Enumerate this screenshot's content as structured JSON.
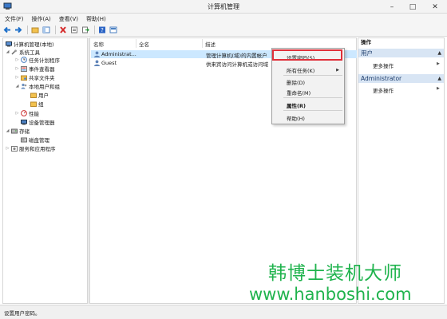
{
  "window": {
    "title": "计算机管理"
  },
  "menu": [
    "文件(F)",
    "操作(A)",
    "查看(V)",
    "帮助(H)"
  ],
  "tree": [
    {
      "label": "计算机管理(本地)",
      "icon": "computer-icon",
      "arrow": "",
      "level": 0
    },
    {
      "label": "系统工具",
      "icon": "tools-icon",
      "arrow": "◢",
      "level": 1
    },
    {
      "label": "任务计划程序",
      "icon": "clock-icon",
      "arrow": "▷",
      "level": 2
    },
    {
      "label": "事件查看器",
      "icon": "event-viewer-icon",
      "arrow": "▷",
      "level": 2
    },
    {
      "label": "共享文件夹",
      "icon": "shared-folder-icon",
      "arrow": "▷",
      "level": 2
    },
    {
      "label": "本地用户和组",
      "icon": "users-icon",
      "arrow": "◢",
      "level": 2
    },
    {
      "label": "用户",
      "icon": "folder-icon",
      "arrow": "",
      "level": 3
    },
    {
      "label": "组",
      "icon": "folder-icon",
      "arrow": "",
      "level": 3
    },
    {
      "label": "性能",
      "icon": "performance-icon",
      "arrow": "▷",
      "level": 2
    },
    {
      "label": "设备管理器",
      "icon": "device-manager-icon",
      "arrow": "",
      "level": 2
    },
    {
      "label": "存储",
      "icon": "storage-icon",
      "arrow": "◢",
      "level": 1
    },
    {
      "label": "磁盘管理",
      "icon": "disk-icon",
      "arrow": "",
      "level": 2
    },
    {
      "label": "服务和应用程序",
      "icon": "services-icon",
      "arrow": "▷",
      "level": 1
    }
  ],
  "list": {
    "columns": [
      "名称",
      "全名",
      "描述"
    ],
    "rows": [
      {
        "name": "Administrat...",
        "desc": "管理计算机(域)的内置帐户",
        "selected": true
      },
      {
        "name": "Guest",
        "desc": "供来宾访问计算机或访问域",
        "selected": false
      }
    ]
  },
  "context_menu": {
    "items": [
      "设置密码(S)...",
      "所有任务(K)",
      "删除(D)",
      "重命名(M)",
      "属性(R)",
      "帮助(H)"
    ],
    "submenu_arrow": "▶"
  },
  "actions": {
    "header": "操作",
    "sections": [
      {
        "title": "用户",
        "item": "更多操作"
      },
      {
        "title": "Administrator",
        "item": "更多操作"
      }
    ]
  },
  "status": "设置用户密码。",
  "watermark": {
    "line1": "韩博士装机大师",
    "line2": "www.hanboshi.com"
  }
}
